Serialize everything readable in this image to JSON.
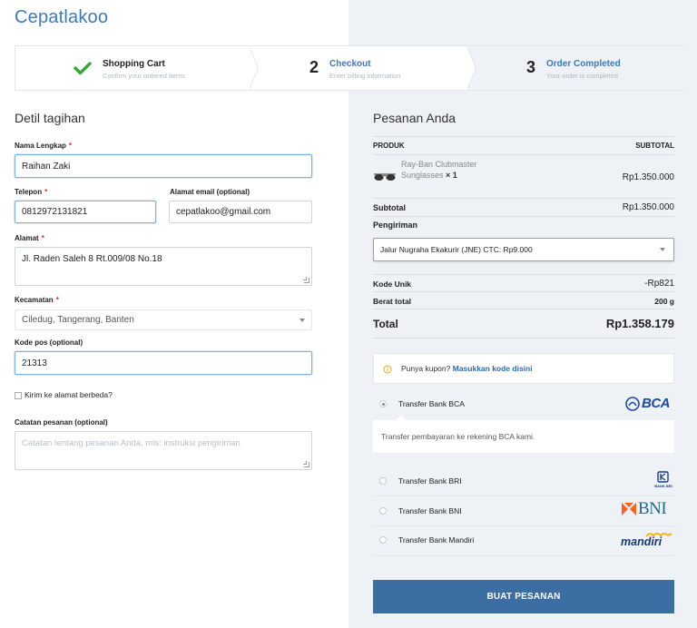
{
  "brand": "Cepatlakoo",
  "steps": [
    {
      "title": "Shopping Cart",
      "subtitle": "Confirm your ordered items",
      "state": "done"
    },
    {
      "number": "2",
      "title": "Checkout",
      "subtitle": "Enter billing information",
      "state": "current"
    },
    {
      "number": "3",
      "title": "Order Completed",
      "subtitle": "Your order is completed",
      "state": "upcoming"
    }
  ],
  "colors": {
    "accent": "#3f7ab1",
    "button": "#3c6da3",
    "check": "#3aa63a",
    "required": "#e02b2b"
  },
  "billing": {
    "title": "Detil tagihan",
    "name_label": "Nama Lengkap",
    "name_value": "Raihan Zaki",
    "phone_label": "Telepon",
    "phone_value": "0812972131821",
    "email_label": "Alamat email (optional)",
    "email_value": "cepatlakoo@gmail.com",
    "address_label": "Alamat",
    "address_value": "Jl. Raden Saleh 8 Rt.009/08 No.18",
    "district_label": "Kecamatan",
    "district_value": "Ciledug, Tangerang, Banten",
    "postcode_label": "Kode pos (optional)",
    "postcode_value": "21313",
    "ship_diff_label": "Kirim ke alamat berbeda?",
    "notes_label": "Catatan pesanan (optional)",
    "notes_placeholder": "Catatan tentang pesanan Anda, mis: instruksi pengiriman",
    "required_mark": "*"
  },
  "order": {
    "title": "Pesanan Anda",
    "col_product": "PRODUK",
    "col_subtotal": "SUBTOTAL",
    "product_line1": "Ray-Ban Clubmaster",
    "product_line2": "Sunglasses",
    "product_qty": "× 1",
    "product_price": "Rp1.350.000",
    "subtotal_label": "Subtotal",
    "subtotal_value": "Rp1.350.000",
    "shipping_label": "Pengiriman",
    "shipping_value": "Jalur Nugraha Ekakurir (JNE) CTC: Rp9.000",
    "unique_label": "Kode Unik",
    "unique_value": "-Rp821",
    "weight_label": "Berat total",
    "weight_value": "200 g",
    "total_label": "Total",
    "total_value": "Rp1.358.179"
  },
  "coupon": {
    "text": "Punya kupon?",
    "link": "Masukkan kode disini"
  },
  "payment": {
    "methods": [
      {
        "label": "Transfer Bank BCA",
        "logo": "BCA",
        "selected": true
      },
      {
        "label": "Transfer Bank BRI",
        "logo": "BANK BRI",
        "selected": false
      },
      {
        "label": "Transfer Bank BNI",
        "logo": "BNI",
        "selected": false
      },
      {
        "label": "Transfer Bank Mandiri",
        "logo": "mandiri",
        "selected": false
      }
    ],
    "bca_description": "Transfer pembayaran ke rekening BCA kami."
  },
  "place_order_label": "BUAT PESANAN"
}
